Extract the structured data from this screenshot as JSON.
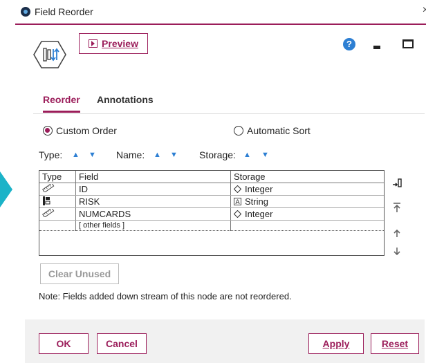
{
  "window": {
    "title": "Field Reorder",
    "close_glyph": "×"
  },
  "toolbar": {
    "preview_label": "Preview",
    "help_glyph": "?"
  },
  "tabs": [
    {
      "label": "Reorder",
      "active": true
    },
    {
      "label": "Annotations",
      "active": false
    }
  ],
  "order_mode": {
    "custom_label": "Custom Order",
    "auto_label": "Automatic Sort",
    "selected": "custom"
  },
  "sort_controls": {
    "type_label": "Type:",
    "name_label": "Name:",
    "storage_label": "Storage:",
    "up_glyph": "▲",
    "down_glyph": "▼"
  },
  "table": {
    "headers": [
      "Type",
      "Field",
      "Storage"
    ],
    "rows": [
      {
        "type_icon": "continuous-ruler-icon",
        "field": "ID",
        "storage_icon": "integer-diamond-icon",
        "storage": "Integer"
      },
      {
        "type_icon": "flag-icon",
        "field": "RISK",
        "storage_icon": "string-a-icon",
        "storage": "String"
      },
      {
        "type_icon": "continuous-ruler-icon",
        "field": "NUMCARDS",
        "storage_icon": "integer-diamond-icon",
        "storage": "Integer"
      }
    ],
    "other_fields_label": "[ other fields ]"
  },
  "side_buttons": [
    "move-to-bottom-icon",
    "move-to-top-icon",
    "move-up-icon",
    "move-down-icon"
  ],
  "clear_unused_label": "Clear Unused",
  "note": "Note: Fields added down stream of this node are not reordered.",
  "footer": {
    "ok": "OK",
    "cancel": "Cancel",
    "apply": "Apply",
    "reset": "Reset"
  },
  "colors": {
    "accent": "#9b1d5a",
    "teal": "#1bb3c8",
    "blue": "#2d7fd3"
  }
}
